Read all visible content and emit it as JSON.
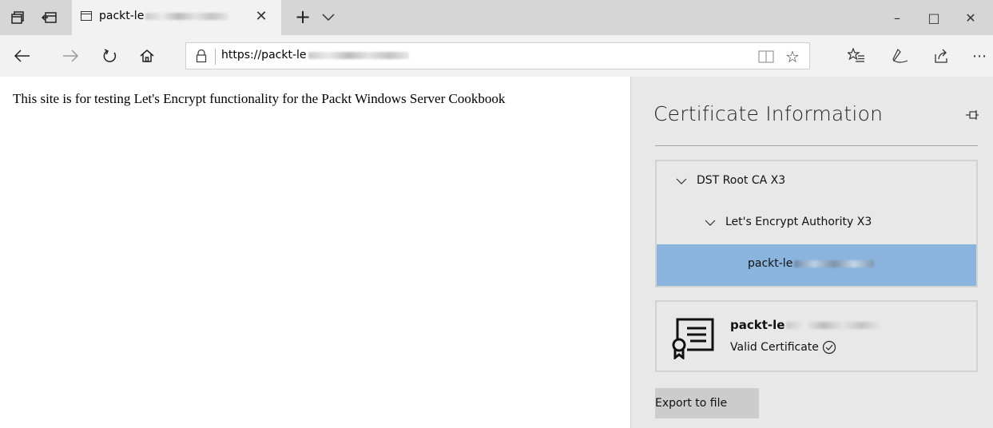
{
  "window": {
    "tab_title": "packt-le",
    "controls": {
      "minimize": "–",
      "maximize": "□",
      "close": "✕"
    }
  },
  "toolbar": {
    "address": "https://packt-le",
    "icons": [
      "back-icon",
      "forward-icon",
      "refresh-icon",
      "home-icon",
      "lock-icon",
      "reading-view-icon",
      "favorite-star-icon",
      "favorites-list-icon",
      "pen-icon",
      "share-icon",
      "more-icon"
    ]
  },
  "page": {
    "body_text": "This site is for testing Let's Encrypt functionality for the Packt Windows Server Cookbook"
  },
  "cert_pane": {
    "title": "Certificate Information",
    "chain": [
      {
        "label": "DST Root CA X3",
        "expanded": true
      },
      {
        "label": "Let's Encrypt Authority X3",
        "expanded": true
      },
      {
        "label": "packt-le",
        "selected": true
      }
    ],
    "card": {
      "name": "packt-le",
      "status": "Valid Certificate"
    },
    "export_label": "Export to file"
  },
  "colors": {
    "titlebar": "#d6d6d6",
    "toolbar": "#f2f2f2",
    "pane": "#e8e8e8",
    "selected_row": "#8ab4dd",
    "button": "#cccccc"
  }
}
